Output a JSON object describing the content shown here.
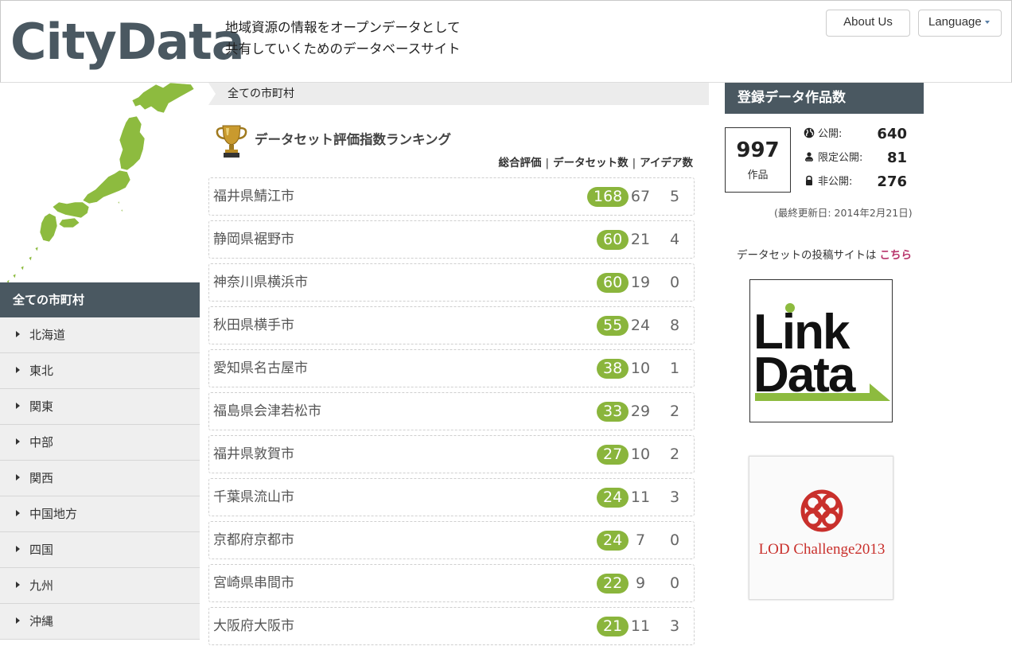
{
  "header": {
    "logo": "CityData",
    "tagline_line1": "地域資源の情報をオープンデータとして",
    "tagline_line2": "共有していくためのデータベースサイト",
    "about_label": "About Us",
    "language_label": "Language"
  },
  "sidebar": {
    "heading": "全ての市町村",
    "items": [
      {
        "label": "北海道"
      },
      {
        "label": "東北"
      },
      {
        "label": "関東"
      },
      {
        "label": "中部"
      },
      {
        "label": "関西"
      },
      {
        "label": "中国地方"
      },
      {
        "label": "四国"
      },
      {
        "label": "九州"
      },
      {
        "label": "沖縄"
      }
    ]
  },
  "main": {
    "breadcrumb": "全ての市町村",
    "ranking_title": "データセット評価指数ランキング",
    "sort_overall": "総合評価",
    "sort_datasets": "データセット数",
    "sort_ideas": "アイデア数",
    "separator": "|",
    "rows": [
      {
        "name": "福井県鯖江市",
        "score": "168",
        "datasets": "67",
        "ideas": "5"
      },
      {
        "name": "静岡県裾野市",
        "score": "60",
        "datasets": "21",
        "ideas": "4"
      },
      {
        "name": "神奈川県横浜市",
        "score": "60",
        "datasets": "19",
        "ideas": "0"
      },
      {
        "name": "秋田県横手市",
        "score": "55",
        "datasets": "24",
        "ideas": "8"
      },
      {
        "name": "愛知県名古屋市",
        "score": "38",
        "datasets": "10",
        "ideas": "1"
      },
      {
        "name": "福島県会津若松市",
        "score": "33",
        "datasets": "29",
        "ideas": "2"
      },
      {
        "name": "福井県敦賀市",
        "score": "27",
        "datasets": "10",
        "ideas": "2"
      },
      {
        "name": "千葉県流山市",
        "score": "24",
        "datasets": "11",
        "ideas": "3"
      },
      {
        "name": "京都府京都市",
        "score": "24",
        "datasets": "7",
        "ideas": "0"
      },
      {
        "name": "宮崎県串間市",
        "score": "22",
        "datasets": "9",
        "ideas": "0"
      },
      {
        "name": "大阪府大阪市",
        "score": "21",
        "datasets": "11",
        "ideas": "3"
      }
    ]
  },
  "stats": {
    "heading": "登録データ作品数",
    "total": "997",
    "total_unit": "作品",
    "public_label": "公開:",
    "public_value": "640",
    "limited_label": "限定公開:",
    "limited_value": "81",
    "private_label": "非公開:",
    "private_value": "276",
    "updated": "(最終更新日: 2014年2月21日)",
    "post_site_text": "データセットの投稿サイトは",
    "post_site_link": "こちら",
    "banner1_line1": "Link",
    "banner1_line2": "Data",
    "banner2_text": "LOD Challenge2013"
  },
  "colors": {
    "accent_dark": "#4a5861",
    "badge_green": "#8ab53c",
    "map_green": "#8dbb3f",
    "link_pink": "#b8336a"
  }
}
